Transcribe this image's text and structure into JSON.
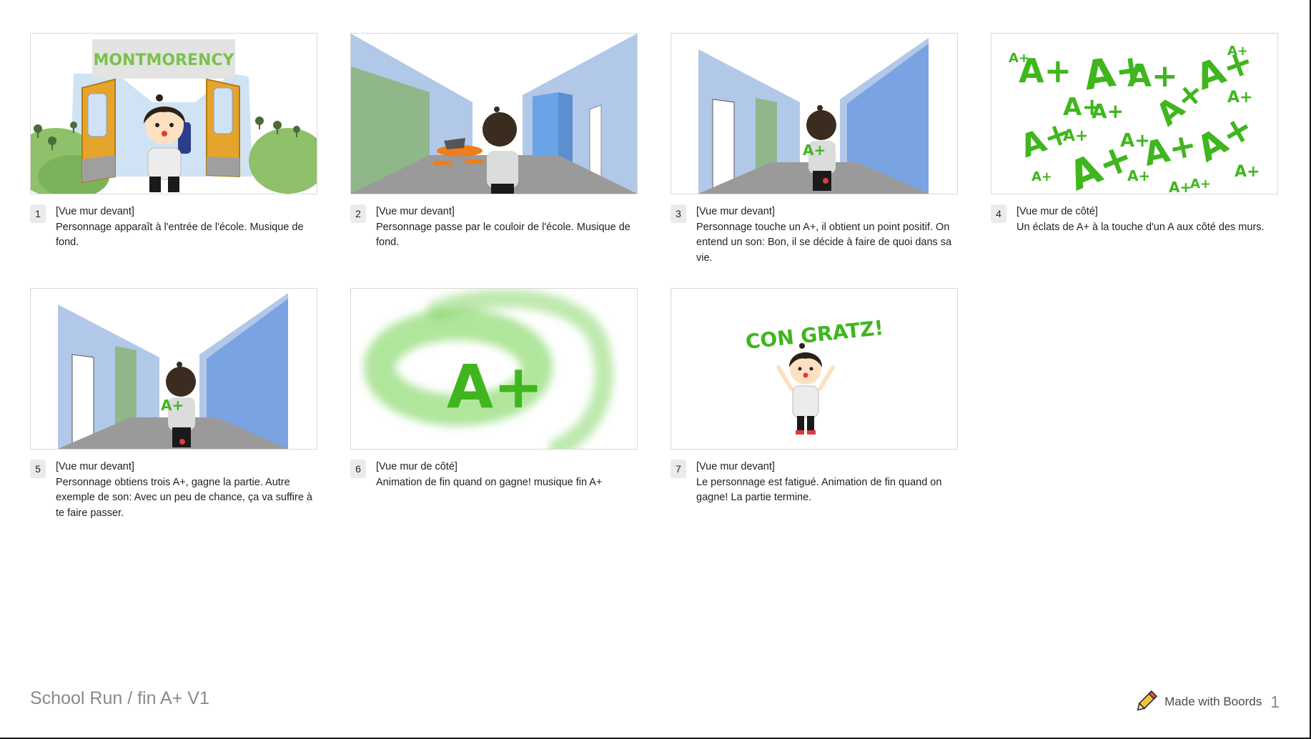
{
  "board": {
    "title": "School Run / fin A+ V1",
    "brand": "Made with Boords",
    "page_number": "1",
    "brand_icon": "pencil-icon"
  },
  "panels": [
    {
      "number": "1",
      "shot": "[Vue mur devant]",
      "description": "Personnage apparaît à l'entrée de l'école. Musique de fond.",
      "sign_text": "MONTMORENCY"
    },
    {
      "number": "2",
      "shot": "[Vue mur devant]",
      "description": "Personnage passe par le couloir de l'école. Musique de fond."
    },
    {
      "number": "3",
      "shot": "[Vue mur devant]",
      "description": "Personnage touche un A+, il obtient un point positif. On entend un son: Bon, il se décide à faire de quoi dans sa vie.",
      "art_text": "A+"
    },
    {
      "number": "4",
      "shot": "[Vue mur de côté]",
      "description": "Un éclats de A+ à la touche d'un A aux côté des murs.",
      "art_text": "A+"
    },
    {
      "number": "5",
      "shot": "[Vue mur devant]",
      "description": "Personnage obtiens trois A+, gagne la partie. Autre exemple de son: Avec un peu de chance, ça va suffire à te faire passer.",
      "art_text": "A+"
    },
    {
      "number": "6",
      "shot": "[Vue mur de côté]",
      "description": "Animation de fin quand on gagne! musique fin A+",
      "art_text": "A+"
    },
    {
      "number": "7",
      "shot": "[Vue mur devant]",
      "description": "Le personnage est fatigué. Animation de fin quand on gagne! La partie termine.",
      "art_text": "CON GRATZ!"
    }
  ],
  "colors": {
    "green": "#3fb61e",
    "wall_light": "#b2c8e8",
    "wall_blue": "#7aa3e3",
    "floor": "#9a9a9a",
    "door_orange": "#e5a42b"
  }
}
